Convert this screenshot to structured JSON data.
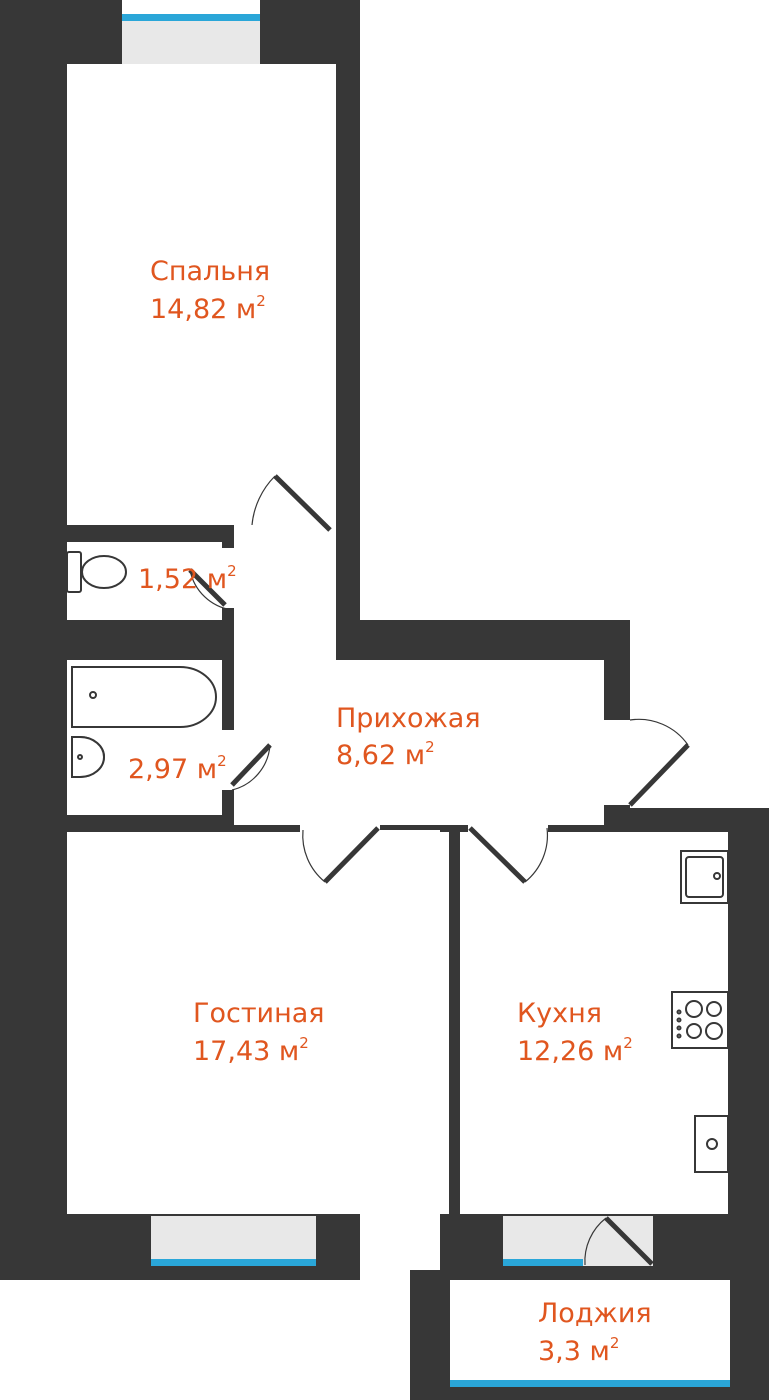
{
  "colors": {
    "wall": "#373737",
    "floor": "#ffffff",
    "window_glass": "#e8e8e8",
    "window_line": "#2aa6d8",
    "label": "#e0561f",
    "fixture_stroke": "#373737"
  },
  "rooms": {
    "bedroom": {
      "name": "Спальня",
      "area": "14,82 м",
      "unit_sup": "2"
    },
    "wc": {
      "name": "",
      "area": "1,52 м",
      "unit_sup": "2"
    },
    "bathroom": {
      "name": "",
      "area": "2,97 м",
      "unit_sup": "2"
    },
    "hallway": {
      "name": "Прихожая",
      "area": "8,62 м",
      "unit_sup": "2"
    },
    "living": {
      "name": "Гостиная",
      "area": "17,43 м",
      "unit_sup": "2"
    },
    "kitchen": {
      "name": "Кухня",
      "area": "12,26 м",
      "unit_sup": "2"
    },
    "loggia": {
      "name": "Лоджия",
      "area": "3,3 м",
      "unit_sup": "2"
    }
  },
  "icons": {
    "toilet": "toilet-icon",
    "bathtub": "bathtub-icon",
    "sink": "sink-icon",
    "stove": "stove-icon",
    "kitchen_sink": "kitchen-sink-icon",
    "fridge": "fridge-icon"
  }
}
